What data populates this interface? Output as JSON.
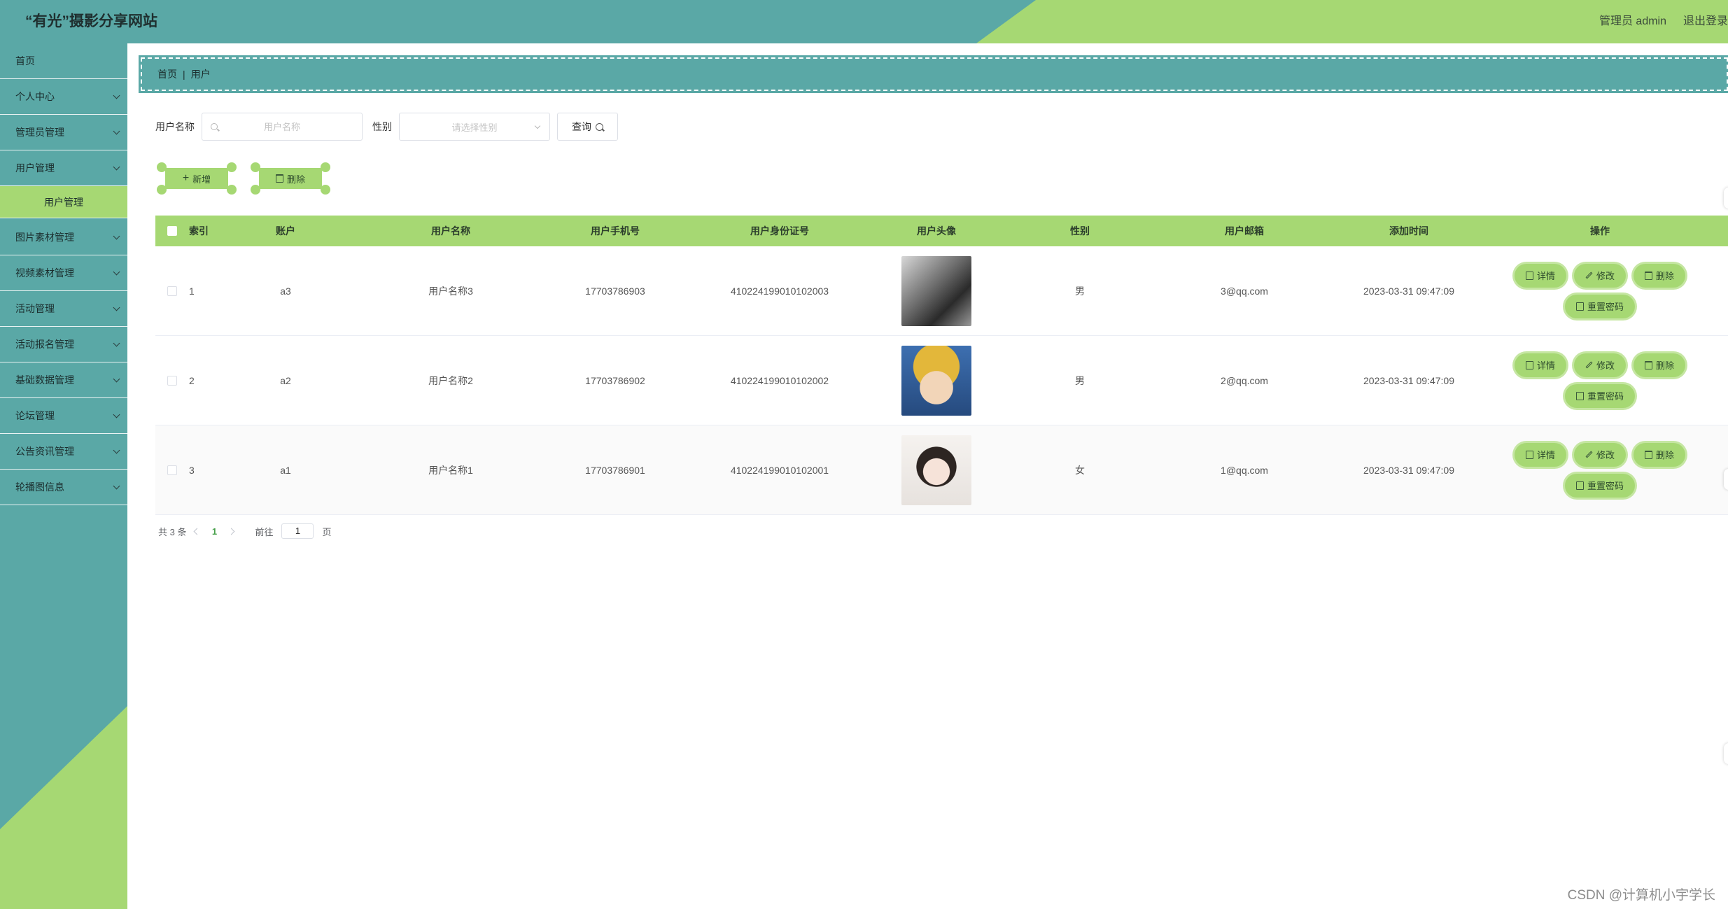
{
  "header": {
    "title": "“有光”摄影分享网站",
    "user": "管理员 admin",
    "logout": "退出登录"
  },
  "sidebar": {
    "items": [
      {
        "label": "首页"
      },
      {
        "label": "个人中心"
      },
      {
        "label": "管理员管理"
      },
      {
        "label": "用户管理"
      },
      {
        "label": "用户管理"
      },
      {
        "label": "图片素材管理"
      },
      {
        "label": "视频素材管理"
      },
      {
        "label": "活动管理"
      },
      {
        "label": "活动报名管理"
      },
      {
        "label": "基础数据管理"
      },
      {
        "label": "论坛管理"
      },
      {
        "label": "公告资讯管理"
      },
      {
        "label": "轮播图信息"
      }
    ]
  },
  "breadcrumb": {
    "home": "首页",
    "sep": "|",
    "current": "用户"
  },
  "search": {
    "name_label": "用户名称",
    "name_placeholder": "用户名称",
    "sex_label": "性别",
    "sex_placeholder": "请选择性别",
    "query_label": "查询"
  },
  "actions": {
    "add": "新增",
    "delete": "删除"
  },
  "table": {
    "headers": [
      "索引",
      "账户",
      "用户名称",
      "用户手机号",
      "用户身份证号",
      "用户头像",
      "性别",
      "用户邮箱",
      "添加时间",
      "操作"
    ],
    "rows": [
      {
        "index": "1",
        "account": "a3",
        "name": "用户名称3",
        "phone": "17703786903",
        "idcard": "410224199010102003",
        "sex": "男",
        "email": "3@qq.com",
        "time": "2023-03-31 09:47:09"
      },
      {
        "index": "2",
        "account": "a2",
        "name": "用户名称2",
        "phone": "17703786902",
        "idcard": "410224199010102002",
        "sex": "男",
        "email": "2@qq.com",
        "time": "2023-03-31 09:47:09"
      },
      {
        "index": "3",
        "account": "a1",
        "name": "用户名称1",
        "phone": "17703786901",
        "idcard": "410224199010102001",
        "sex": "女",
        "email": "1@qq.com",
        "time": "2023-03-31 09:47:09"
      }
    ],
    "ops": {
      "detail": "详情",
      "edit": "修改",
      "delete": "删除",
      "reset": "重置密码"
    }
  },
  "pager": {
    "total": "共 3 条",
    "current": "1",
    "goto_prefix": "前往",
    "goto_value": "1",
    "goto_suffix": "页"
  },
  "watermark": "CSDN @计算机小宇学长",
  "colors": {
    "teal": "#5aa8a6",
    "green": "#a6d873"
  }
}
